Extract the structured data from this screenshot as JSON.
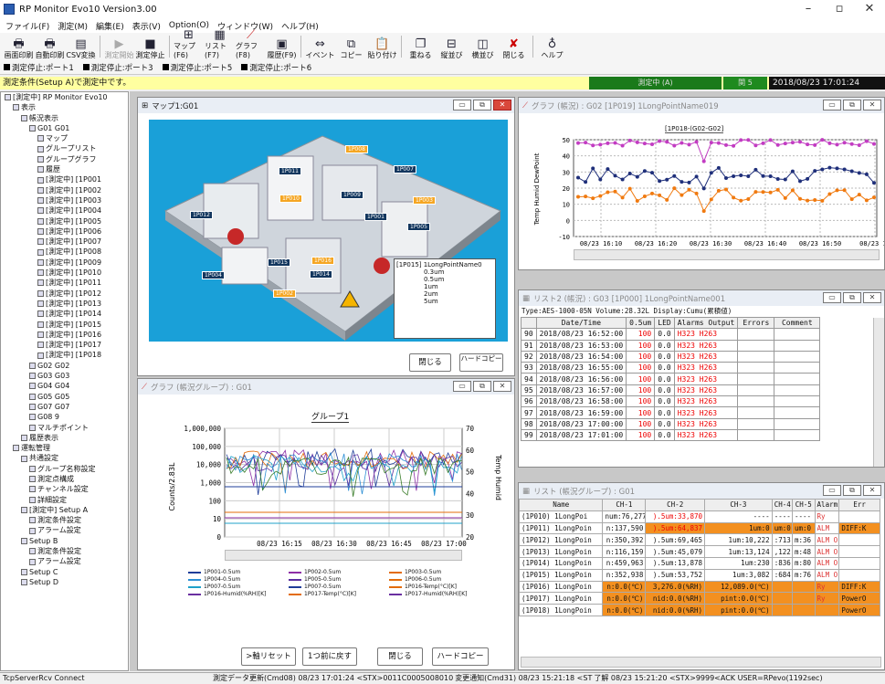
{
  "app": {
    "title": "RP Monitor Evo10 Version3.00"
  },
  "menu": [
    "ファイル(F)",
    "測定(M)",
    "編集(E)",
    "表示(V)",
    "Option(O)",
    "ウィンドウ(W)",
    "ヘルプ(H)"
  ],
  "toolbar": [
    {
      "label": "画面印刷",
      "icon": "print-screen-icon"
    },
    {
      "label": "自動印刷",
      "icon": "auto-print-icon"
    },
    {
      "label": "CSV変換",
      "icon": "csv-icon"
    },
    {
      "label": "測定開始",
      "icon": "play-icon"
    },
    {
      "label": "測定停止",
      "icon": "stop-icon"
    },
    {
      "label": "マップ(F6)",
      "icon": "map-icon"
    },
    {
      "label": "リスト(F7)",
      "icon": "list-icon"
    },
    {
      "label": "グラフ(F8)",
      "icon": "graph-icon"
    },
    {
      "label": "履歴(F9)",
      "icon": "history-icon"
    },
    {
      "label": "イベント",
      "icon": "event-icon"
    },
    {
      "label": "コピー",
      "icon": "copy-icon"
    },
    {
      "label": "貼り付け",
      "icon": "paste-icon"
    },
    {
      "label": "重ねる",
      "icon": "cascade-icon"
    },
    {
      "label": "縦並び",
      "icon": "tile-vertical-icon"
    },
    {
      "label": "横並び",
      "icon": "tile-horizontal-icon"
    },
    {
      "label": "閉じる",
      "icon": "close-icon"
    },
    {
      "label": "ヘルプ",
      "icon": "help-icon"
    }
  ],
  "ports": [
    "測定停止:ポート1",
    "測定停止:ポート3",
    "測定停止:ポート5",
    "測定停止:ポート6"
  ],
  "status": {
    "condition": "測定条件(Setup A)で測定中です。",
    "measuring": "測定中 (A)",
    "datetime": "2018/08/23 17:01:24",
    "green2": "関 5"
  },
  "tree": [
    "[測定中] RP Monitor Evo10",
    "表示",
    "帳況表示",
    "G01 G01",
    "マップ",
    "グループリスト",
    "グループグラフ",
    "履歴",
    "[測定中] [1P001",
    "[測定中] [1P002",
    "[測定中] [1P003",
    "[測定中] [1P004",
    "[測定中] [1P005",
    "[測定中] [1P006",
    "[測定中] [1P007",
    "[測定中] [1P008",
    "[測定中] [1P009",
    "[測定中] [1P010",
    "[測定中] [1P011",
    "[測定中] [1P012",
    "[測定中] [1P013",
    "[測定中] [1P014",
    "[測定中] [1P015",
    "[測定中] [1P016",
    "[測定中] [1P017",
    "[測定中] [1P018",
    "G02 G02",
    "G03 G03",
    "G04 G04",
    "G05 G05",
    "G07 G07",
    "G08 9",
    "マルチポイント",
    "履歴表示",
    "運転管理",
    "共通設定",
    "グループ名称設定",
    "測定点構成",
    "チャンネル設定",
    "詳細設定",
    "[測定中] Setup A",
    "測定条件設定",
    "アラーム設定",
    "Setup B",
    "測定条件設定",
    "アラーム設定",
    "Setup C",
    "Setup D"
  ],
  "map_window": {
    "title": "マップ1:G01",
    "close_label": "閉じる",
    "hardcopy_label": "ハードコピー",
    "labels": [
      "1P008",
      "1P007",
      "1P011",
      "1P010",
      "1P009",
      "1P001",
      "1P003",
      "1P005",
      "1P004",
      "1P002",
      "1P012",
      "1P015",
      "1P016",
      "1P014"
    ],
    "legend": {
      "title": "[1P015] 1LongPointName0",
      "items": [
        "0.3um",
        "0.5um",
        "1um",
        "2um",
        "5um"
      ]
    }
  },
  "graph_window_top": {
    "title": "グラフ (帳況) : G02 [1P019] 1LongPointName019",
    "legend": "[1P018-(G02-G02]",
    "ylabel": "Temp Humid DewPoint",
    "xticks": [
      "08/23 16:10",
      "08/23 16:20",
      "08/23 16:30",
      "08/23 16:40",
      "08/23 16:50",
      "08/23 17"
    ],
    "yticks": [
      "50",
      "40",
      "30",
      "20",
      "10",
      "0",
      "-10"
    ]
  },
  "list_window": {
    "title": "リスト2 (帳況) : G03 [1P000] 1LongPointName001",
    "info": "Type:AES-1000-05N Volume:28.32L Display:Cumu(累積値)",
    "headers": [
      "",
      "Date/Time",
      "0.5um",
      "LED",
      "Alarms Output",
      "Errors",
      "Comment"
    ],
    "rows": [
      [
        "90",
        "2018/08/23 16:52:00",
        "100",
        "0.0",
        "H323 H263",
        "",
        ""
      ],
      [
        "91",
        "2018/08/23 16:53:00",
        "100",
        "0.0",
        "H323 H263",
        "",
        ""
      ],
      [
        "92",
        "2018/08/23 16:54:00",
        "100",
        "0.0",
        "H323 H263",
        "",
        ""
      ],
      [
        "93",
        "2018/08/23 16:55:00",
        "100",
        "0.0",
        "H323 H263",
        "",
        ""
      ],
      [
        "94",
        "2018/08/23 16:56:00",
        "100",
        "0.0",
        "H323 H263",
        "",
        ""
      ],
      [
        "95",
        "2018/08/23 16:57:00",
        "100",
        "0.0",
        "H323 H263",
        "",
        ""
      ],
      [
        "96",
        "2018/08/23 16:58:00",
        "100",
        "0.0",
        "H323 H263",
        "",
        ""
      ],
      [
        "97",
        "2018/08/23 16:59:00",
        "100",
        "0.0",
        "H323 H263",
        "",
        ""
      ],
      [
        "98",
        "2018/08/23 17:00:00",
        "100",
        "0.0",
        "H323 H263",
        "",
        ""
      ],
      [
        "99",
        "2018/08/23 17:01:00",
        "100",
        "0.0",
        "H323 H263",
        "",
        ""
      ]
    ]
  },
  "graph_window_bottom": {
    "title": "グラフ (帳況グループ) : G01",
    "chart_title": "グループ1",
    "ylabel": "Counts/2.83L",
    "y2label": "Temp Humid",
    "yticks": [
      "1,000,000",
      "100,000",
      "10,000",
      "1,000",
      "100",
      "10",
      "0"
    ],
    "y2ticks": [
      "70",
      "60",
      "50",
      "40",
      "30",
      "20"
    ],
    "xticks": [
      "08/23 16:15",
      "08/23 16:30",
      "08/23 16:45",
      "08/23 17:00"
    ],
    "legend": [
      "1P001-0.5um",
      "1P002-0.5um",
      "1P003-0.5um",
      "1P004-0.5um",
      "1P005-0.5um",
      "1P006-0.5um",
      "1P007-0.5um",
      "1P007-0.5um",
      "1P016-Temp(°C)[K]",
      "1P016-Humid(%RH)[K]",
      "1P017-Temp(°C)[K]",
      "1P017-Humid(%RH)[K]"
    ],
    "buttons": {
      "reset": ">軸リセット",
      "back": "1つ前に戻す",
      "close": "閉じる",
      "hardcopy": "ハードコピー"
    }
  },
  "group_list": {
    "title": "リスト (帳況グループ) : G01",
    "headers": [
      "Name",
      "CH-1",
      "CH-2",
      "CH-3",
      "CH-4",
      "CH-5",
      "Alarms",
      "Err"
    ],
    "rows": [
      [
        "(1P010) 1LongPoi",
        "num:76,277",
        ").5um:33,870",
        "----",
        "----",
        "----",
        "Ry",
        ""
      ],
      [
        "(1P011) 1LongPoin",
        "n:137,590",
        ").5um:64,837",
        "1um:0",
        "um:0",
        "um:0",
        "ALM",
        "DIFF:K"
      ],
      [
        "(1P012) 1LongPoin",
        "n:350,392",
        ").5um:69,465",
        "1um:10,222",
        ":713",
        "m:36",
        "ALM O",
        ""
      ],
      [
        "(1P013) 1LongPoin",
        "n:116,159",
        ").5um:45,079",
        "1um:13,124",
        ",122",
        "m:48",
        "ALM O",
        ""
      ],
      [
        "(1P014) 1LongPoin",
        "n:459,963",
        ").5um:13,878",
        "1um:230",
        ":836",
        "m:80",
        "ALM O",
        ""
      ],
      [
        "(1P015) 1LongPoin",
        "n:352,938",
        ").5um:53,752",
        "1um:3,082",
        ":684",
        "m:76",
        "ALM O",
        ""
      ],
      [
        "(1P016) 1LongPoin",
        "n:0.0(℃)",
        "3,276.0(%RH)",
        "12,089.0(℃)",
        "",
        "",
        "Ry",
        "DIFF:K"
      ],
      [
        "(1P017) 1LongPoin",
        "n:0.0(℃)",
        "nid:0.0(%RH)",
        "pint:0.0(℃)",
        "",
        "",
        "Ry",
        "PowerO"
      ],
      [
        "(1P018) 1LongPoin",
        "n:0.0(℃)",
        "nid:0.0(%RH)",
        "pint:0.0(℃)",
        "",
        "",
        "",
        "PowerO"
      ]
    ]
  },
  "bottom_status": {
    "left": "TcpServerRcv Connect",
    "msg1": "測定データ更新(Cmd08) 08/23 17:01:24 <STX>0011C0005008010",
    "msg2": "変更通知(Cmd31) 08/23 15:21:18 <ST",
    "msg3": "了解 08/23 15:21:20 <STX>9999<ACK USER=RPevo(1192sec)"
  }
}
